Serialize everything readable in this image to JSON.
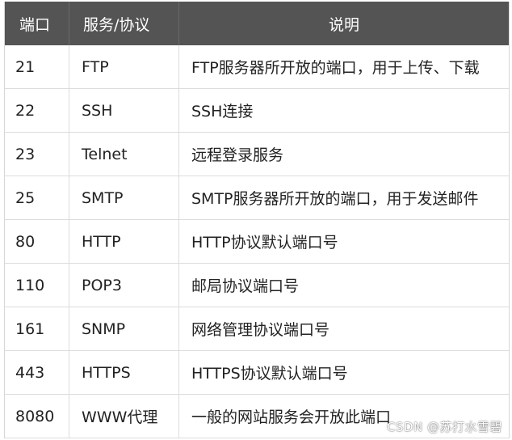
{
  "table": {
    "headers": [
      "端口",
      "服务/协议",
      "说明"
    ],
    "rows": [
      [
        "21",
        "FTP",
        "FTP服务器所开放的端口，用于上传、下载"
      ],
      [
        "22",
        "SSH",
        "SSH连接"
      ],
      [
        "23",
        "Telnet",
        "远程登录服务"
      ],
      [
        "25",
        "SMTP",
        "SMTP服务器所开放的端口，用于发送邮件"
      ],
      [
        "80",
        "HTTP",
        "HTTP协议默认端口号"
      ],
      [
        "110",
        "POP3",
        "邮局协议端口号"
      ],
      [
        "161",
        "SNMP",
        "网络管理协议端口号"
      ],
      [
        "443",
        "HTTPS",
        "HTTPS协议默认端口号"
      ],
      [
        "8080",
        "WWW代理",
        "一般的网站服务会开放此端口"
      ]
    ]
  },
  "watermark": "CSDN @苏打水雪碧",
  "colors": {
    "header_bg": "#545454",
    "header_text": "#ffffff",
    "border": "#dcdcdc"
  }
}
